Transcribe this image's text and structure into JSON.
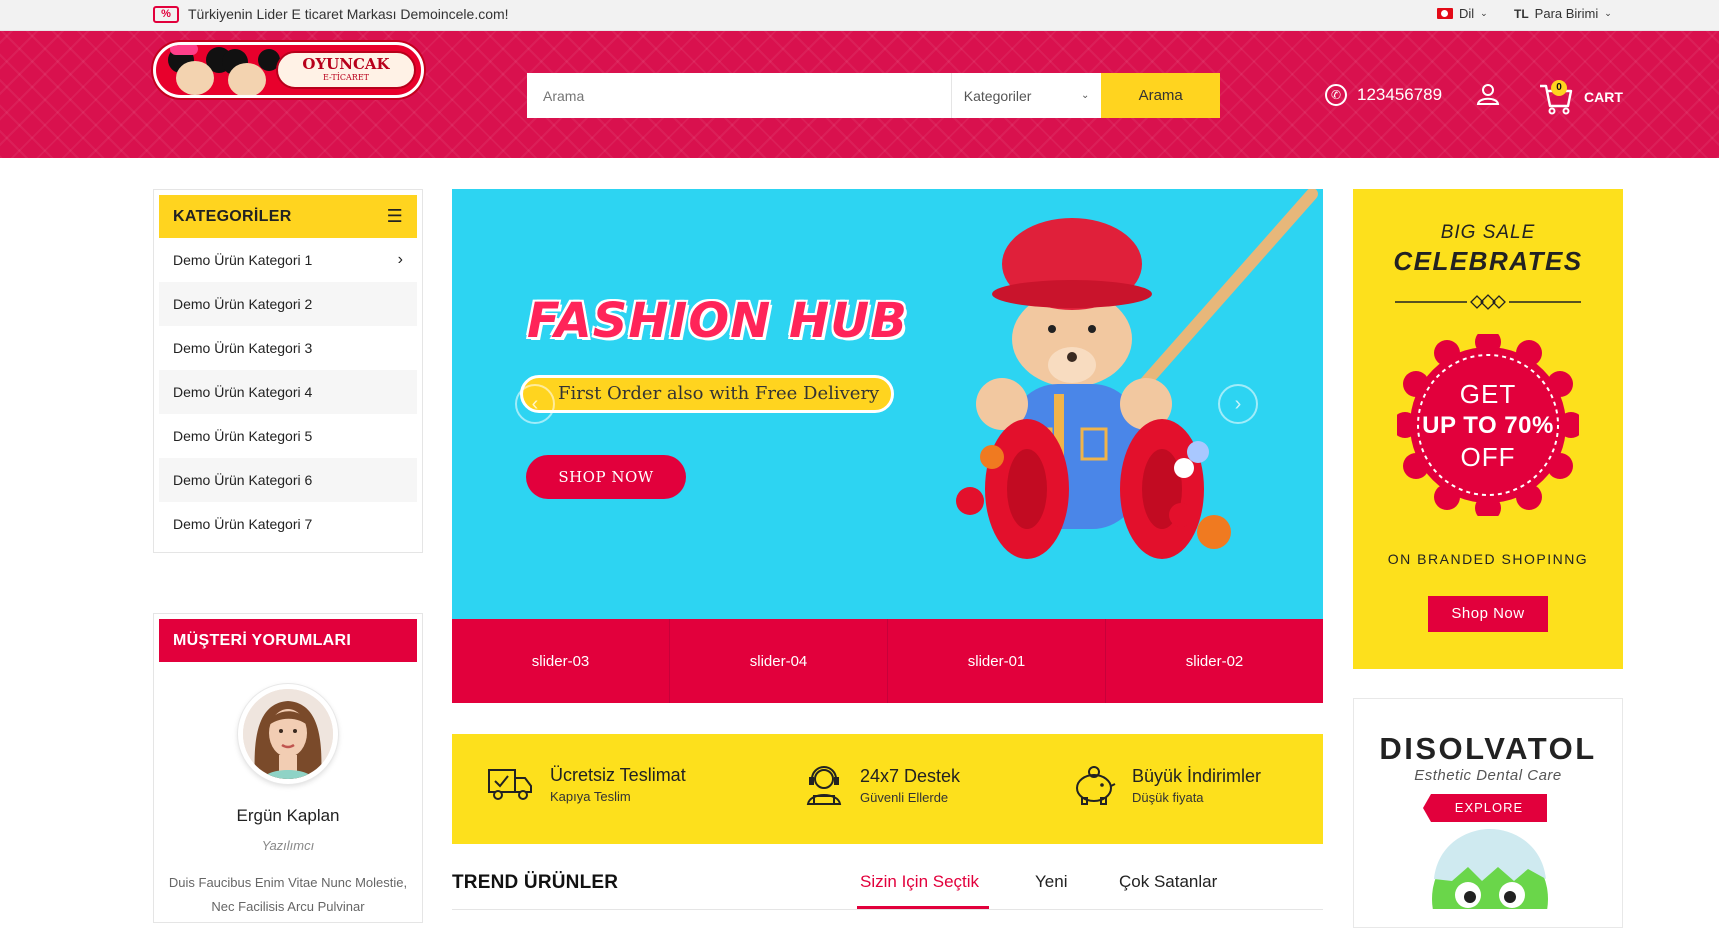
{
  "topbar": {
    "badge": "%",
    "announcement": "Türkiyenin Lider E ticaret Markası Demoincele.com!",
    "language_label": "Dil",
    "currency_code": "TL",
    "currency_label": "Para Birimi"
  },
  "header": {
    "logo": {
      "line1": "OYUNCAK",
      "line2": "E-TİCARET"
    },
    "search_placeholder": "Arama",
    "category_select": "Kategoriler",
    "search_button": "Arama",
    "phone": "123456789",
    "cart_count": "0",
    "cart_label": "CART"
  },
  "categories": {
    "title": "KATEGORİLER",
    "items": [
      {
        "label": "Demo Ürün Kategori 1"
      },
      {
        "label": "Demo Ürün Kategori 2"
      },
      {
        "label": "Demo Ürün Kategori 3"
      },
      {
        "label": "Demo Ürün Kategori 4"
      },
      {
        "label": "Demo Ürün Kategori 5"
      },
      {
        "label": "Demo Ürün Kategori 6"
      },
      {
        "label": "Demo Ürün Kategori 7"
      }
    ]
  },
  "reviews": {
    "title": "MÜŞTERİ YORUMLARI",
    "name": "Ergün Kaplan",
    "role": "Yazılımcı",
    "text": "Duis Faucibus Enim Vitae Nunc Molestie, Nec Facilisis Arcu Pulvinar"
  },
  "slider": {
    "title": "FASHION HUB",
    "subtitle": "First Order also with Free Delivery",
    "button": "SHOP NOW",
    "thumbs": [
      "slider-03",
      "slider-04",
      "slider-01",
      "slider-02"
    ]
  },
  "features": [
    {
      "title": "Ücretsiz Teslimat",
      "sub": "Kapıya Teslim",
      "icon": "truck-icon"
    },
    {
      "title": "24x7 Destek",
      "sub": "Güvenli Ellerde",
      "icon": "support-agent-icon"
    },
    {
      "title": "Büyük İndirimler",
      "sub": "Düşük fiyata",
      "icon": "piggy-bank-icon"
    }
  ],
  "trend": {
    "title": "TREND ÜRÜNLER",
    "tabs": [
      "Sizin Için Seçtik",
      "Yeni",
      "Çok Satanlar"
    ]
  },
  "sale_banner": {
    "line1": "BIG SALE",
    "line2": "CELEBRATES",
    "badge_line1": "GET",
    "badge_line2": "UP TO 70%",
    "badge_line3": "OFF",
    "line3": "ON BRANDED SHOPINNG",
    "button": "Shop Now"
  },
  "promo_banner": {
    "brand": "DISOLVATOL",
    "tagline": "Esthetic Dental Care",
    "button": "EXPLORE"
  },
  "colors": {
    "primary_red": "#e2003c",
    "header_red": "#d9114e",
    "yellow": "#fde01c",
    "slider_blue": "#2dd4f2"
  }
}
